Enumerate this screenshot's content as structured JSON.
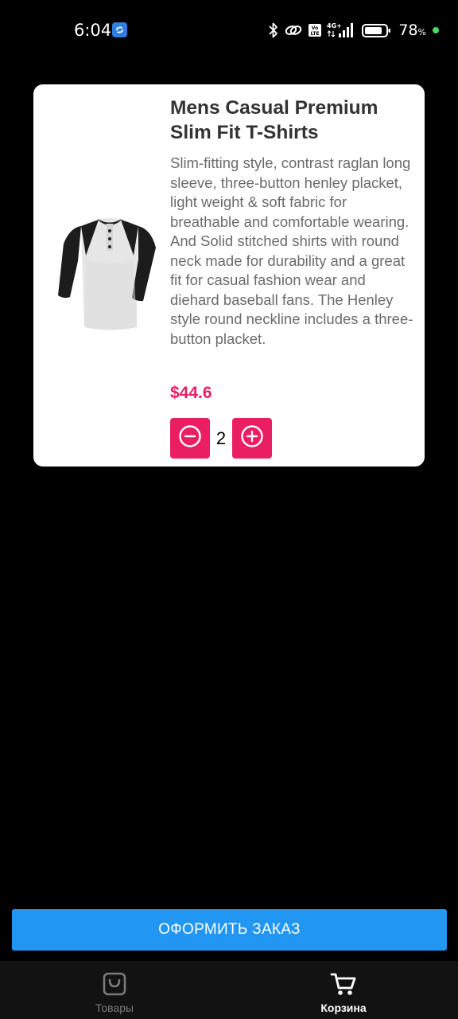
{
  "status_bar": {
    "time": "6:04",
    "battery_percent": "78",
    "battery_unit": "%",
    "network": "4G+",
    "volte": "Vo LTE",
    "icons": [
      "bluetooth-icon",
      "link-icon",
      "volte-icon",
      "signal-icon",
      "battery-icon"
    ]
  },
  "cart": {
    "items": [
      {
        "title": "Mens Casual Premium Slim Fit T-Shirts",
        "description": "Slim-fitting style, contrast raglan long sleeve, three-button henley placket, light weight & soft fabric for breathable and comfortable wearing. And Solid stitched shirts with round neck made for durability and a great fit for casual fashion wear and diehard baseball fans. The Henley style round neckline includes a three-button placket.",
        "price": "$44.6",
        "quantity": "2",
        "decrease_icon": "minus-circle-icon",
        "increase_icon": "plus-circle-icon"
      }
    ]
  },
  "checkout": {
    "label": "ОФОРМИТЬ ЗАКАЗ"
  },
  "bottom_nav": {
    "items": [
      {
        "label": "Товары",
        "icon": "shopping-bag-icon",
        "active": false
      },
      {
        "label": "Корзина",
        "icon": "cart-icon",
        "active": true
      }
    ]
  },
  "colors": {
    "accent": "#e91e63",
    "primary_button": "#2196f3",
    "background": "#000000",
    "nav_background": "#121212"
  }
}
